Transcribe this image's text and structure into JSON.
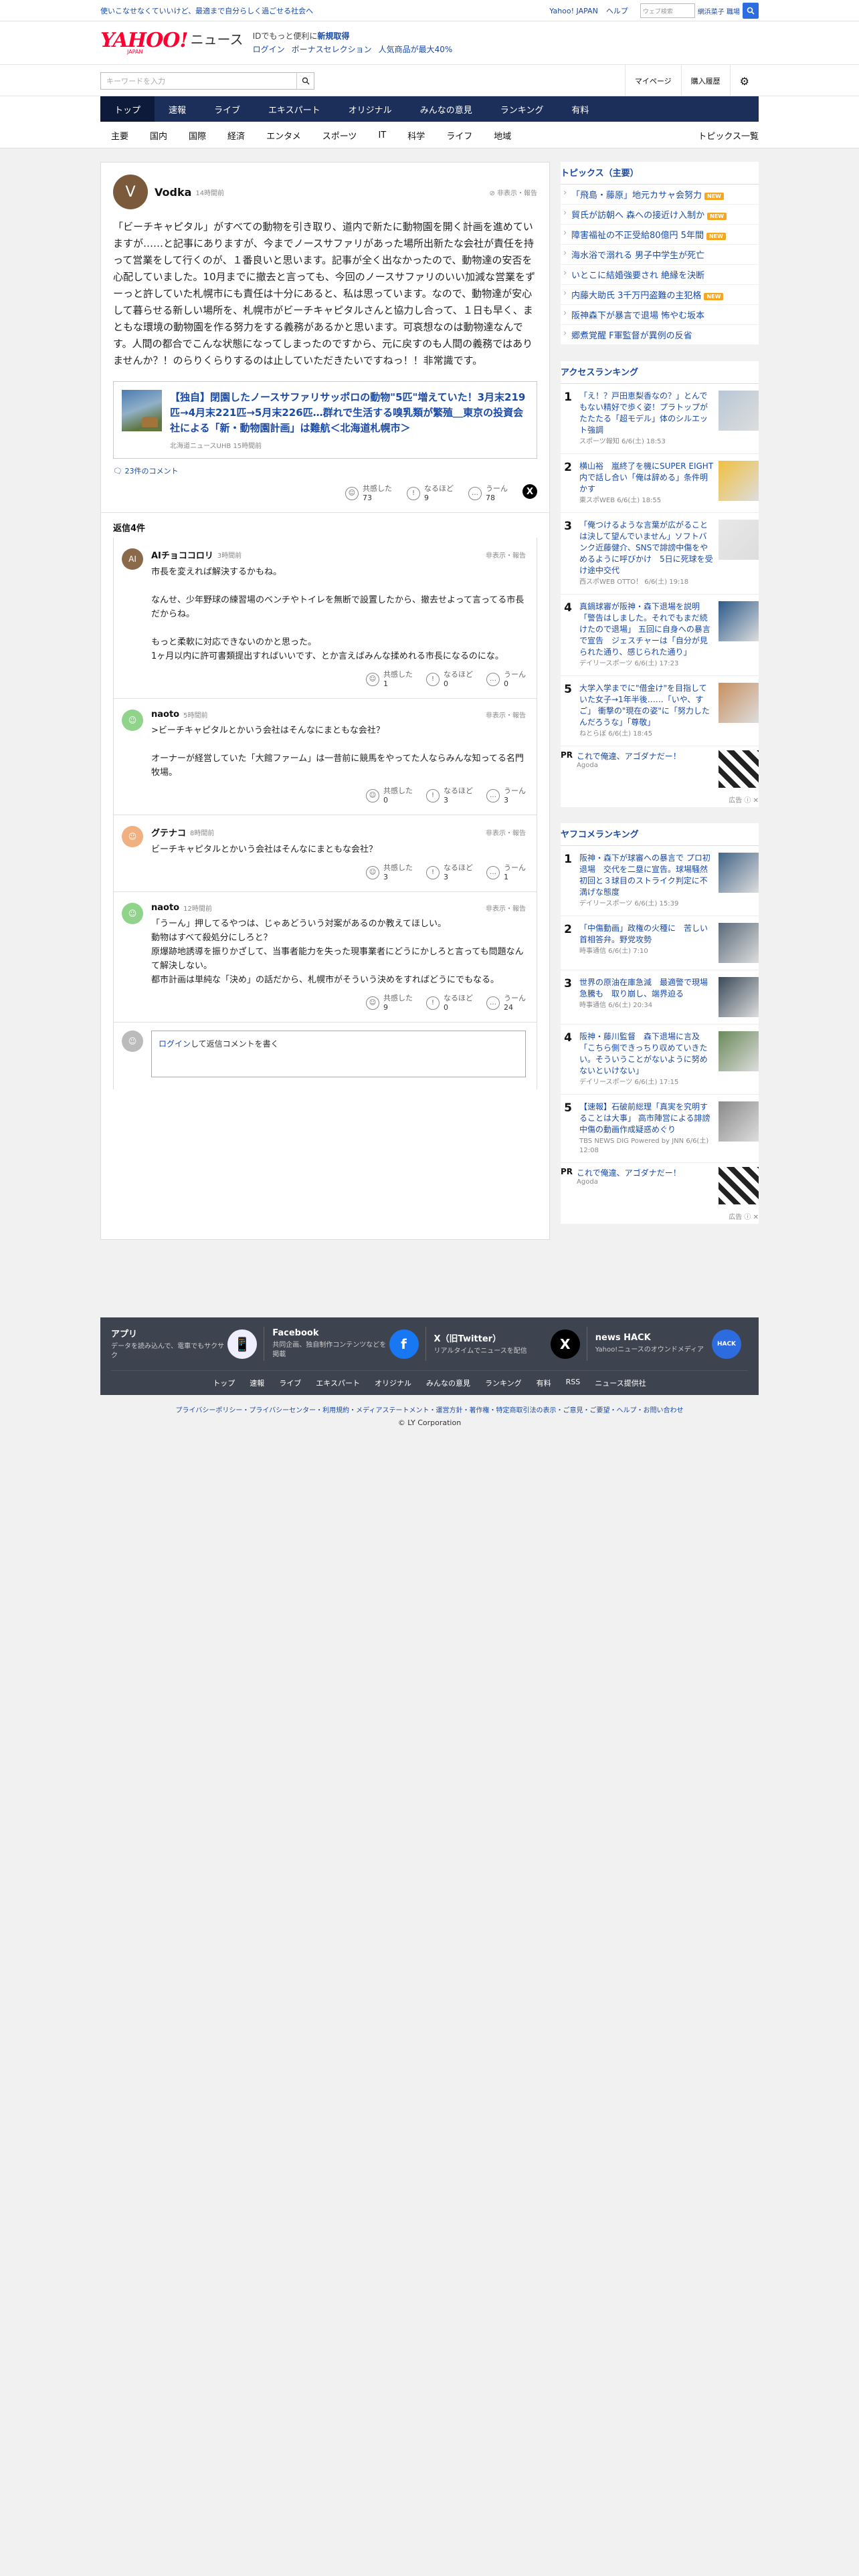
{
  "topbar": {
    "promo": "使いこなせなくていいけど、最適まで自分らしく過ごせる社会へ",
    "yahoo_japan": "Yahoo! JAPAN",
    "help": "ヘルプ",
    "weather_placeholder": "ウェブ検索",
    "location": "網浜菜子 職場"
  },
  "header": {
    "logo": "YAHOO!",
    "logo_sub": "JAPAN",
    "logo_news": "ニュース",
    "id_line_prefix": "IDでもっと便利に",
    "id_line_link": "新規取得",
    "login": "ログイン",
    "bonus": "ボーナスセレクション",
    "popular": "人気商品が最大40%"
  },
  "search": {
    "placeholder": "キーワードを入力",
    "mypage": "マイページ",
    "history": "購入履歴"
  },
  "nav_primary": [
    "トップ",
    "速報",
    "ライブ",
    "エキスパート",
    "オリジナル",
    "みんなの意見",
    "ランキング",
    "有料"
  ],
  "nav_secondary": [
    "主要",
    "国内",
    "国際",
    "経済",
    "エンタメ",
    "スポーツ",
    "IT",
    "科学",
    "ライフ",
    "地域"
  ],
  "nav_secondary_right": "トピックス一覧",
  "post": {
    "user": "Vodka",
    "time": "14時間前",
    "report": "非表示・報告",
    "body": "「ビーチキャピタル」がすべての動物を引き取り、道内で新たに動物園を開く計画を進めていますが……と記事にありますが、今までノースサファリがあった場所出新たな会社が責任を持って営業をして行くのが、１番良いと思います。記事が全く出なかったので、動物達の安否を心配していました。10月までに撤去と言っても、今回のノースサファリのいい加減な営業をずーっと許していた札幌市にも責任は十分にあると、私は思っています。なので、動物達が安心して暮らせる新しい場所を、札幌市がビーチキャピタルさんと協力し合って、１日も早く、まともな環境の動物園を作る努力をする義務があるかと思います。可哀想なのは動物達なんです。人間の都合でこんな状態になってしまったのですから、元に戻すのも人間の義務ではありませんか？！のらりくらりするのは止していただきたいですねっ！！非常識です。",
    "article_title": "【独自】閉園したノースサファリサッポロの動物\"5匹\"増えていた！3月末219匹→4月末221匹→5月末226匹…群れで生活する嗅乳類が繁殖＿東京の投資会社による「新・動物園計画」は難航＜北海道札幌市＞",
    "article_source": "北海道ニュースUHB 15時間前",
    "comment_count": "23件のコメント",
    "reactions": {
      "empathy_label": "共感した",
      "empathy": "73",
      "naruhodo_label": "なるほど",
      "naruhodo": "9",
      "uun_label": "うーん",
      "uun": "78"
    },
    "replies_label": "返信4件"
  },
  "replies": [
    {
      "user": "AIチョココロリ",
      "time": "3時間前",
      "report": "非表示・報告",
      "text": "市長を変えれば解決するかもね。\n\nなんせ、少年野球の練習場のベンチやトイレを無断で設置したから、撤去せよって言ってる市長だからね。\n\nもっと柔軟に対応できないのかと思った。\n1ヶ月以内に許可書類提出すればいいです、とか言えばみんな揉めれる市長になるのにな。",
      "empathy": "1",
      "naruhodo": "0",
      "uun": "0",
      "av": "#8a6a4a"
    },
    {
      "user": "naoto",
      "time": "5時間前",
      "report": "非表示・報告",
      "text": ">ビーチキャピタルとかいう会社はそんなにまともな会社？\n\nオーナーが経営していた「大館ファーム」は一昔前に競馬をやってた人ならみんな知ってる名門牧場。",
      "empathy": "0",
      "naruhodo": "3",
      "uun": "3",
      "av": "#8fd48a"
    },
    {
      "user": "グテナコ",
      "time": "8時間前",
      "report": "非表示・報告",
      "text": "ビーチキャピタルとかいう会社はそんなにまともな会社？",
      "empathy": "3",
      "naruhodo": "3",
      "uun": "1",
      "av": "#f0b080"
    },
    {
      "user": "naoto",
      "time": "12時間前",
      "report": "非表示・報告",
      "text": "「うーん」押してるやつは、じゃあどういう対案があるのか教えてほしい。\n動物はすべて殺処分にしろと？\n原爆跡地誘導を振りかざして、当事者能力を失った現事業者にどうにかしろと言っても問題なんて解決しない。\n都市計画は単純な「決め」の話だから、札幌市がそういう決めをすればどうにでもなる。",
      "empathy": "9",
      "naruhodo": "0",
      "uun": "24",
      "av": "#8fd48a"
    }
  ],
  "reply_input": {
    "login": "ログイン",
    "text": "して返信コメントを書く"
  },
  "topics": {
    "title": "トピックス（主要）",
    "items": [
      {
        "t": "「飛島・藤原」地元カサャ会努力",
        "new": true
      },
      {
        "t": "貿氏が訪朝へ 森への接近け入制か",
        "new": true
      },
      {
        "t": "障害福祉の不正受給80億円 5年間",
        "new": true
      },
      {
        "t": "海水浴で溺れる 男子中学生が死亡",
        "new": false
      },
      {
        "t": "いとこに結婚強要され 絶縁を決断",
        "new": false
      },
      {
        "t": "内藤大助氏 3千万円盗難の主犯格",
        "new": true
      },
      {
        "t": "阪神森下が暴言で退場 怖やむ坂本",
        "new": false
      },
      {
        "t": "郷煮覚醒 F軍監督が異例の反省",
        "new": false
      }
    ]
  },
  "access_ranking": {
    "title": "アクセスランキング",
    "items": [
      {
        "n": "1",
        "t": "「え！？戸田恵梨香なの？」とんでもない精好で歩く姿！プラトップがたたたる「超モデル」体のシルエット強調",
        "s": "スポーツ報知 6/6(土) 18:53",
        "c": "#b8c7d6"
      },
      {
        "n": "2",
        "t": "横山裕　嵐終了を機にSUPER EIGHT内で話し合い「俺は辞める」条件明かす",
        "s": "東スポWEB 6/6(土) 18:55",
        "c": "#f0c040"
      },
      {
        "n": "3",
        "t": "「俺つけるような言葉が広がることは決して望んでいません」ソフトバンク近藤健介、SNSで誹謗中傷をやめるように呼びかけ　5日に死球を受け途中交代",
        "s": "西スポWEB OTTO！ 6/6(土) 19:18",
        "c": "#e8e8e8"
      },
      {
        "n": "4",
        "t": "真鍋球審が阪神・森下退場を説明「警告はしました。それでもまだ続けたので退場」 五回に自身への暴言で宣告　ジェスチャーは「自分が見られた通り、感じられた通り」",
        "s": "デイリースポーツ 6/6(土) 17:23",
        "c": "#2c5a8a"
      },
      {
        "n": "5",
        "t": "大学入学までに\"借金け\"を目指していた女子→1年半後……「いや、すご」 衝撃の\"現在の姿\"に「努力したんだろうな」「尊敬」",
        "s": "ねとらぼ 6/6(土) 18:45",
        "c": "#c89060"
      }
    ],
    "pr_label": "PR",
    "pr_text": "これで俺違、アゴダナだー！",
    "pr_source": "Agoda",
    "ad_label": "広告"
  },
  "yahoo_comment_ranking": {
    "title": "ヤフコメランキング",
    "items": [
      {
        "n": "1",
        "t": "阪神・森下が球審への暴言で プロ初退場　交代を二塁に宣告。球場騒然　初回と３球目のストライク判定に不満げな態度",
        "s": "デイリースポーツ 6/6(土) 15:39",
        "c": "#446688"
      },
      {
        "n": "2",
        "t": "「中傷動画」政権の火種に　苦しい首相答弁。野党攻勢",
        "s": "時事通信 6/6(土) 7:10",
        "c": "#5a6a7a"
      },
      {
        "n": "3",
        "t": "世界の原油在庫急減　最適警で現場急騰も　取り崩し、端界迫る",
        "s": "時事通信 6/6(土) 20:34",
        "c": "#3a4a5a"
      },
      {
        "n": "4",
        "t": "阪神・藤川監督　森下退場に言及「こちら側できっちり収めていきたい。そういうことがないように努めないといけない」",
        "s": "デイリースポーツ 6/6(土) 17:15",
        "c": "#6a8a5a"
      },
      {
        "n": "5",
        "t": "【速報】石破前総理「真実を究明することは大事」 高市陣営による誹謗中傷の動画作成疑惑めぐり",
        "s": "TBS NEWS DIG Powered by JNN 6/6(土) 12:08",
        "c": "#8a8a8a"
      }
    ],
    "pr_label": "PR",
    "pr_text": "これで俺違、アゴダナだー！",
    "pr_source": "Agoda",
    "ad_label": "広告"
  },
  "footer": {
    "cards": [
      {
        "t": "アプリ",
        "d": "データを読み込んで、電車でもサクサク",
        "c": "#eef",
        "i": "📱"
      },
      {
        "t": "Facebook",
        "d": "共同企画、独自制作コンテンツなどを掲載",
        "c": "#1877f2",
        "i": "f"
      },
      {
        "t": "X（旧Twitter）",
        "d": "リアルタイムでニュースを配信",
        "c": "#000",
        "i": "X"
      },
      {
        "t": "news HACK",
        "d": "Yahoo!ニュースのオウンドメディア",
        "c": "#2d6cdf",
        "i": "HACK"
      }
    ],
    "links": [
      "トップ",
      "速報",
      "ライブ",
      "エキスパート",
      "オリジナル",
      "みんなの意見",
      "ランキング",
      "有料",
      "RSS",
      "ニュース提供社"
    ],
    "legal": "プライバシーポリシー・プライバシーセンター・利用規約・メディアステートメント・運営方針・著作権・特定商取引法の表示・ご意見・ご要望・ヘルプ・お問い合わせ",
    "copyright": "© LY Corporation"
  }
}
